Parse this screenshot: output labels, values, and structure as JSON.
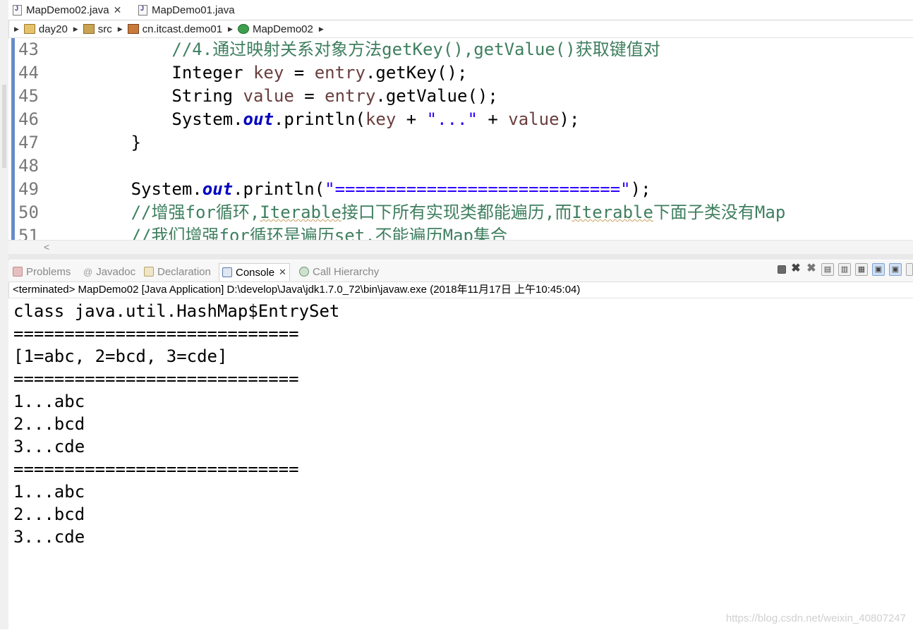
{
  "editor_tabs": [
    {
      "label": "MapDemo02.java",
      "close": "✕"
    },
    {
      "label": "MapDemo01.java"
    }
  ],
  "breadcrumb": [
    "day20",
    "src",
    "cn.itcast.demo01",
    "MapDemo02"
  ],
  "code": {
    "lines": [
      {
        "num": "43",
        "text": "            //4.通过映射关系对象方法getKey(),getValue()获取键值对"
      },
      {
        "num": "44",
        "text": "            Integer key = entry.getKey();"
      },
      {
        "num": "45",
        "text": "            String value = entry.getValue();"
      },
      {
        "num": "46",
        "text": "            System.out.println(key + \"...\" + value);"
      },
      {
        "num": "47",
        "text": "        }"
      },
      {
        "num": "48",
        "text": ""
      },
      {
        "num": "49",
        "text": "        System.out.println(\"============================\");"
      },
      {
        "num": "50",
        "text": "        //增强for循环,Iterable接口下所有实现类都能遍历,而Iterable下面子类没有Map"
      },
      {
        "num": "51",
        "text": "        //我们增强for循环是遍历set,不能遍历Map集合"
      }
    ]
  },
  "view_tabs": [
    {
      "label": "Problems"
    },
    {
      "label": "Javadoc"
    },
    {
      "label": "Declaration"
    },
    {
      "label": "Console",
      "close": "✕"
    },
    {
      "label": "Call Hierarchy"
    }
  ],
  "console": {
    "terminated": "<terminated> MapDemo02 [Java Application] D:\\develop\\Java\\jdk1.7.0_72\\bin\\javaw.exe (2018年11月17日 上午10:45:04)",
    "output": [
      "class java.util.HashMap$EntrySet",
      "============================",
      "[1=abc, 2=bcd, 3=cde]",
      "============================",
      "1...abc",
      "2...bcd",
      "3...cde",
      "============================",
      "1...abc",
      "2...bcd",
      "3...cde"
    ]
  },
  "watermark": "https://blog.csdn.net/weixin_40807247"
}
